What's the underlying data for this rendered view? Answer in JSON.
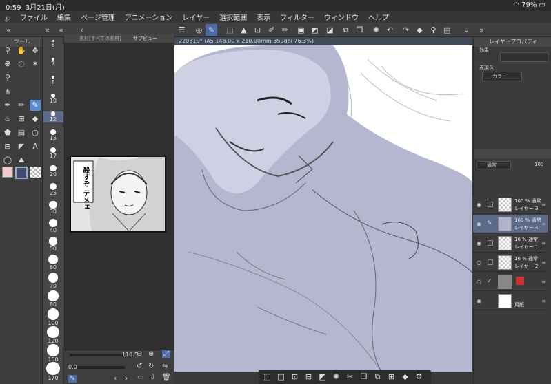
{
  "status": {
    "time": "0:59",
    "date": "3月21日(月)",
    "battery": "79%",
    "wifi_icon": "wifi-icon"
  },
  "menu": [
    "ファイル",
    "編集",
    "ページ管理",
    "アニメーション",
    "レイヤー",
    "選択範囲",
    "表示",
    "フィルター",
    "ウィンドウ",
    "ヘルプ"
  ],
  "tool_panel": {
    "title": "ツール"
  },
  "material_tabs": {
    "left": "素材[すべての素材]",
    "right": "サブビュー"
  },
  "brush_sizes": [
    "6",
    "7",
    "8",
    "10",
    "12",
    "15",
    "17",
    "20",
    "25",
    "30",
    "40",
    "50",
    "60",
    "70",
    "80",
    "100",
    "120",
    "150",
    "170"
  ],
  "nav": {
    "zoom": "110.5",
    "angle": "0.0"
  },
  "canvas": {
    "title": "220319* (A5 148.00 x 210.00mm 350dpi 76.3%)"
  },
  "layer_property": {
    "title": "レイヤープロパティ",
    "effect_label": "効果",
    "expression_label": "表現色",
    "expression_value": "カラー"
  },
  "layer_panel": {
    "blend": "通常",
    "opacity": "100"
  },
  "layers": [
    {
      "pct": "100 %",
      "blend": "通常",
      "name": "レイヤー 3"
    },
    {
      "pct": "100 %",
      "blend": "通常",
      "name": "レイヤー 4"
    },
    {
      "pct": "16 %",
      "blend": "通常",
      "name": "レイヤー 1"
    },
    {
      "pct": "16 %",
      "blend": "通常",
      "name": "レイヤー 2"
    },
    {
      "pct": "",
      "blend": "",
      "name": ""
    },
    {
      "pct": "",
      "blend": "",
      "name": "用紙"
    }
  ],
  "reference_text": "殺すぞ テメェ",
  "colors": {
    "main": "#f4c8d0",
    "sub": "#3e4a6e",
    "accent": "#5a8ad0"
  }
}
